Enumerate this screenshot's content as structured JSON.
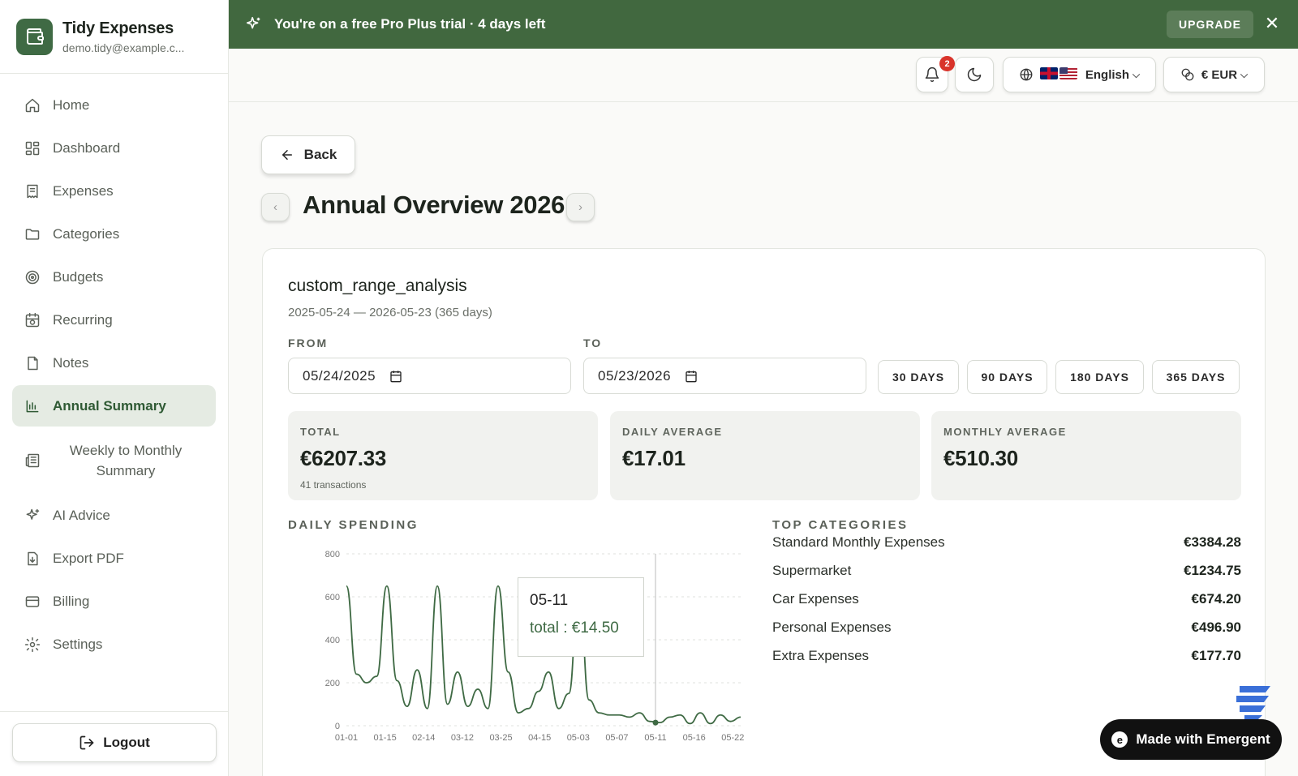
{
  "app": {
    "name": "Tidy Expenses",
    "email": "demo.tidy@example.c..."
  },
  "sidebar": {
    "items": [
      {
        "label": "Home",
        "icon": "home-icon"
      },
      {
        "label": "Dashboard",
        "icon": "dashboard-icon"
      },
      {
        "label": "Expenses",
        "icon": "receipt-icon"
      },
      {
        "label": "Categories",
        "icon": "folder-icon"
      },
      {
        "label": "Budgets",
        "icon": "target-icon"
      },
      {
        "label": "Recurring",
        "icon": "calendar-repeat-icon"
      },
      {
        "label": "Notes",
        "icon": "note-icon"
      },
      {
        "label": "Annual Summary",
        "icon": "bar-chart-icon",
        "active": true
      },
      {
        "label": "Weekly to Monthly Summary",
        "icon": "newspaper-icon"
      },
      {
        "label": "AI Advice",
        "icon": "sparkles-icon"
      },
      {
        "label": "Export PDF",
        "icon": "file-download-icon"
      },
      {
        "label": "Billing",
        "icon": "credit-card-icon"
      },
      {
        "label": "Settings",
        "icon": "gear-icon"
      }
    ],
    "logout_label": "Logout"
  },
  "banner": {
    "text": "You're on a free Pro Plus trial · 4 days left",
    "upgrade_label": "UPGRADE"
  },
  "topbar": {
    "notification_count": "2",
    "language": "English",
    "currency": "€ EUR"
  },
  "back_label": "Back",
  "page_title": "Annual Overview 2026",
  "card": {
    "title": "custom_range_analysis",
    "subtitle": "2025-05-24 — 2026-05-23 (365 days)",
    "from_label": "FROM",
    "to_label": "TO",
    "from_value": "05/24/2025",
    "to_value": "05/23/2026",
    "range_buttons": [
      "30 DAYS",
      "90 DAYS",
      "180 DAYS",
      "365 DAYS"
    ]
  },
  "stats": [
    {
      "label": "TOTAL",
      "value": "€6207.33",
      "note": "41 transactions"
    },
    {
      "label": "DAILY AVERAGE",
      "value": "€17.01"
    },
    {
      "label": "MONTHLY AVERAGE",
      "value": "€510.30"
    }
  ],
  "daily_spending_label": "DAILY SPENDING",
  "top_categories_label": "TOP CATEGORIES",
  "top_categories": [
    {
      "name": "Standard Monthly Expenses",
      "amount": "€3384.28"
    },
    {
      "name": "Supermarket",
      "amount": "€1234.75"
    },
    {
      "name": "Car Expenses",
      "amount": "€674.20"
    },
    {
      "name": "Personal Expenses",
      "amount": "€496.90"
    },
    {
      "name": "Extra Expenses",
      "amount": "€177.70"
    }
  ],
  "tooltip": {
    "date": "05-11",
    "label": "total : €14.50"
  },
  "emergent_label": "Made with Emergent",
  "colors": {
    "brand": "#41683f",
    "line": "#3f6a44",
    "active_bg": "#e5ebe3"
  },
  "chart_data": {
    "type": "line",
    "title": "",
    "xlabel": "",
    "ylabel": "",
    "ylim": [
      0,
      800
    ],
    "yticks": [
      0,
      200,
      400,
      600,
      800
    ],
    "x_tick_labels": [
      "01-01",
      "01-15",
      "02-14",
      "03-12",
      "03-25",
      "04-15",
      "05-03",
      "05-07",
      "05-11",
      "05-16",
      "05-22"
    ],
    "series": [
      {
        "values": [
          650,
          240,
          200,
          230,
          650,
          210,
          90,
          260,
          80,
          650,
          100,
          250,
          90,
          170,
          80,
          650,
          250,
          60,
          80,
          160,
          250,
          80,
          150,
          650,
          120,
          60,
          50,
          50,
          40,
          60,
          20,
          14.5,
          40,
          50,
          10,
          60,
          10,
          50,
          20,
          40
        ]
      }
    ],
    "highlight": {
      "x": "05-11",
      "y": 14.5
    },
    "grid": true
  }
}
